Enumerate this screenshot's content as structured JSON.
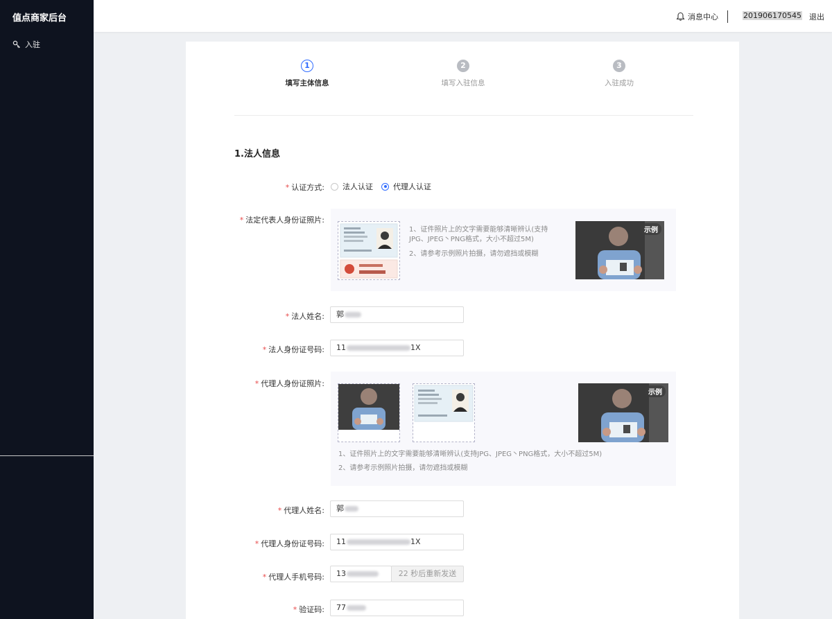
{
  "app": {
    "brand": "值点商家后台"
  },
  "sidebar": {
    "items": [
      {
        "label": "入驻",
        "icon": "key-icon"
      }
    ]
  },
  "topbar": {
    "messages_label": "消息中心",
    "account": "201906170545",
    "logout": "退出"
  },
  "steps": [
    {
      "num": "1",
      "label": "填写主体信息",
      "state": "active"
    },
    {
      "num": "2",
      "label": "填写入驻信息",
      "state": "inactive"
    },
    {
      "num": "3",
      "label": "入驻成功",
      "state": "inactive"
    }
  ],
  "section": {
    "title": "1.法人信息"
  },
  "form": {
    "auth_method": {
      "label": "认证方式:",
      "options": [
        "法人认证",
        "代理人认证"
      ],
      "selected": "代理人认证"
    },
    "legal_id_photo": {
      "label": "法定代表人身份证照片:",
      "hint1": "1、证件照片上的文字需要能够清晰辨认(支持JPG、JPEG丶PNG格式，大小不超过5M)",
      "hint2": "2、请参考示例照片拍摄，请勿遮挡或模糊",
      "example_badge": "示例"
    },
    "legal_name": {
      "label": "法人姓名:",
      "value": "郭"
    },
    "legal_id_no": {
      "label": "法人身份证号码:",
      "prefix": "11",
      "suffix": "1X"
    },
    "agent_id_photo": {
      "label": "代理人身份证照片:",
      "hint1": "1、证件照片上的文字需要能够清晰辨认(支持JPG、JPEG丶PNG格式，大小不超过5M)",
      "hint2": "2、请参考示例照片拍摄，请勿遮挡或模糊",
      "example_badge": "示例"
    },
    "agent_name": {
      "label": "代理人姓名:",
      "value": "郭"
    },
    "agent_id_no": {
      "label": "代理人身份证号码:",
      "prefix": "11",
      "suffix": "1X"
    },
    "agent_phone": {
      "label": "代理人手机号码:",
      "prefix": "13",
      "resend_label": "22 秒后重新发送"
    },
    "verify_code": {
      "label": "验证码:",
      "prefix": "77"
    }
  },
  "colors": {
    "sidebar_bg": "#0e131f",
    "accent": "#2f6bff",
    "required": "#e84a4a"
  }
}
